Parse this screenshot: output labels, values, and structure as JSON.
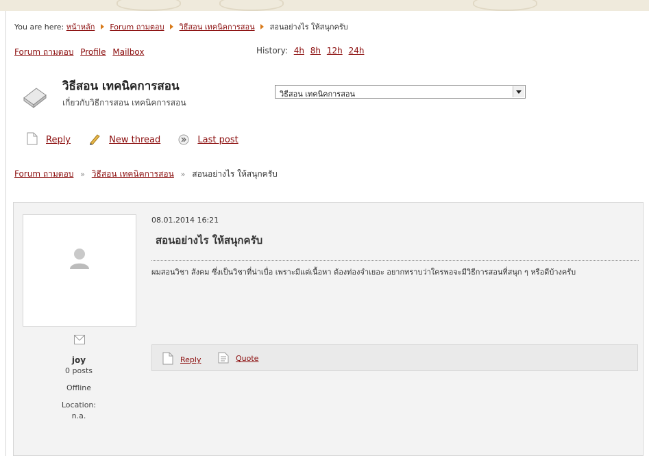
{
  "breadcrumb_top": {
    "prefix": "You are here:",
    "items": [
      "หน้าหลัก",
      "Forum ถามตอบ",
      "วิธีสอน เทคนิคการสอน"
    ],
    "current": "สอนอย่างไร ให้สนุกครับ"
  },
  "nav": {
    "links": [
      "Forum ถามตอบ",
      "Profile",
      "Mailbox"
    ],
    "history_label": "History:",
    "history_links": [
      "4h",
      "8h",
      "12h",
      "24h"
    ]
  },
  "forum": {
    "title": "วิธีสอน เทคนิคการสอน",
    "description": "เกี่ยวกับวิธีการสอน เทคนิคการสอน",
    "select_value": "วิธีสอน เทคนิคการสอน",
    "icon": "book-icon"
  },
  "actions": {
    "reply": "Reply",
    "new_thread": "New thread",
    "last_post": "Last post",
    "icons": [
      "document-icon",
      "pencil-icon",
      "last-post-icon"
    ]
  },
  "breadcrumb_mid": {
    "items": [
      "Forum ถามตอบ",
      "วิธีสอน เทคนิคการสอน"
    ],
    "current": "สอนอย่างไร ให้สนุกครับ"
  },
  "post": {
    "date": "08.01.2014 16:21",
    "title": "สอนอย่างไร ให้สนุกครับ",
    "body": "ผมสอนวิชา สังคม ซึ่งเป็นวิชาที่น่าเบื่อ เพราะมีแต่เนื้อหา ต้องท่องจำเยอะ อยากทราบว่าใครพอจะมีวิธีการสอนที่สนุก ๆ หรือดีบ้างครับ",
    "reply_label": "Reply",
    "quote_label": "Quote"
  },
  "author": {
    "name": "joy",
    "posts": "0 posts",
    "status": "Offline",
    "location_label": "Location:",
    "location": "n.a."
  },
  "colors": {
    "link": "#8a0b0b",
    "arrow": "#d87a1a",
    "panel_bg": "#f3f3f3",
    "top_band": "#efeadc"
  }
}
